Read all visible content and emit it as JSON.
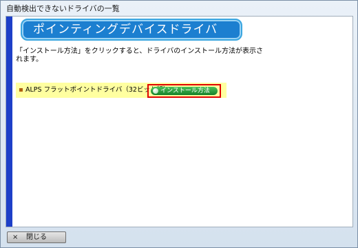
{
  "window": {
    "title": "自動検出できないドライバの一覧"
  },
  "header": {
    "banner": "ポインティングデバイスドライバ"
  },
  "content": {
    "instruction": "「インストール方法」をクリックすると、ドライバのインストール方法が表示されます。"
  },
  "driver_list": [
    {
      "label": "ALPS フラットポイントドライバ（32ビット版）",
      "action": "インストール方法"
    }
  ],
  "footer": {
    "close_label": "閉じる",
    "close_icon": "×"
  },
  "colors": {
    "accent_stripe": "#1d3fc8",
    "banner": "#1c7fd0",
    "row_highlight": "#ffffa0",
    "install_button": "#16802a",
    "focus_outline": "#e00000"
  }
}
